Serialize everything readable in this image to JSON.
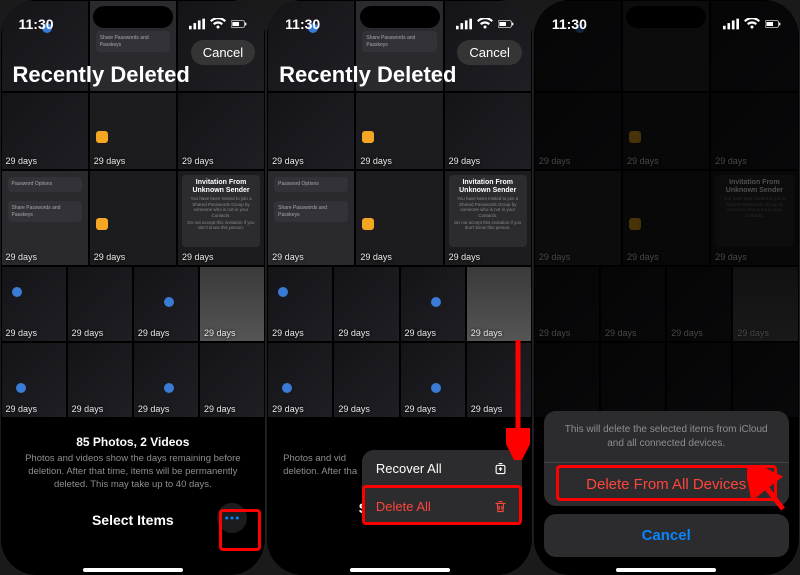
{
  "status": {
    "time": "11:30"
  },
  "nav": {
    "cancel": "Cancel",
    "title": "Recently Deleted"
  },
  "days": "29 days",
  "invite": {
    "title": "Invitation From Unknown Sender",
    "line1": "You have been invited to join a Shared Passwords Group by someone who is not in your Contacts.",
    "line2": "Do not accept this invitation if you don't know this person."
  },
  "panel1": {
    "summary_title": "85 Photos, 2 Videos",
    "summary_body": "Photos and videos show the days remaining before deletion. After that time, items will be permanently deleted. This may take up to 40 days.",
    "select": "Select Items"
  },
  "panel2": {
    "summary_truncated_a": "Photos and vid",
    "summary_truncated_b": "deletion. After tha",
    "select": "Select Items",
    "menu": {
      "recover": "Recover All",
      "delete": "Delete All"
    }
  },
  "panel3": {
    "sheet_msg": "This will delete the selected items from iCloud and all connected devices.",
    "delete_all_devices": "Delete From All Devices",
    "cancel": "Cancel"
  }
}
